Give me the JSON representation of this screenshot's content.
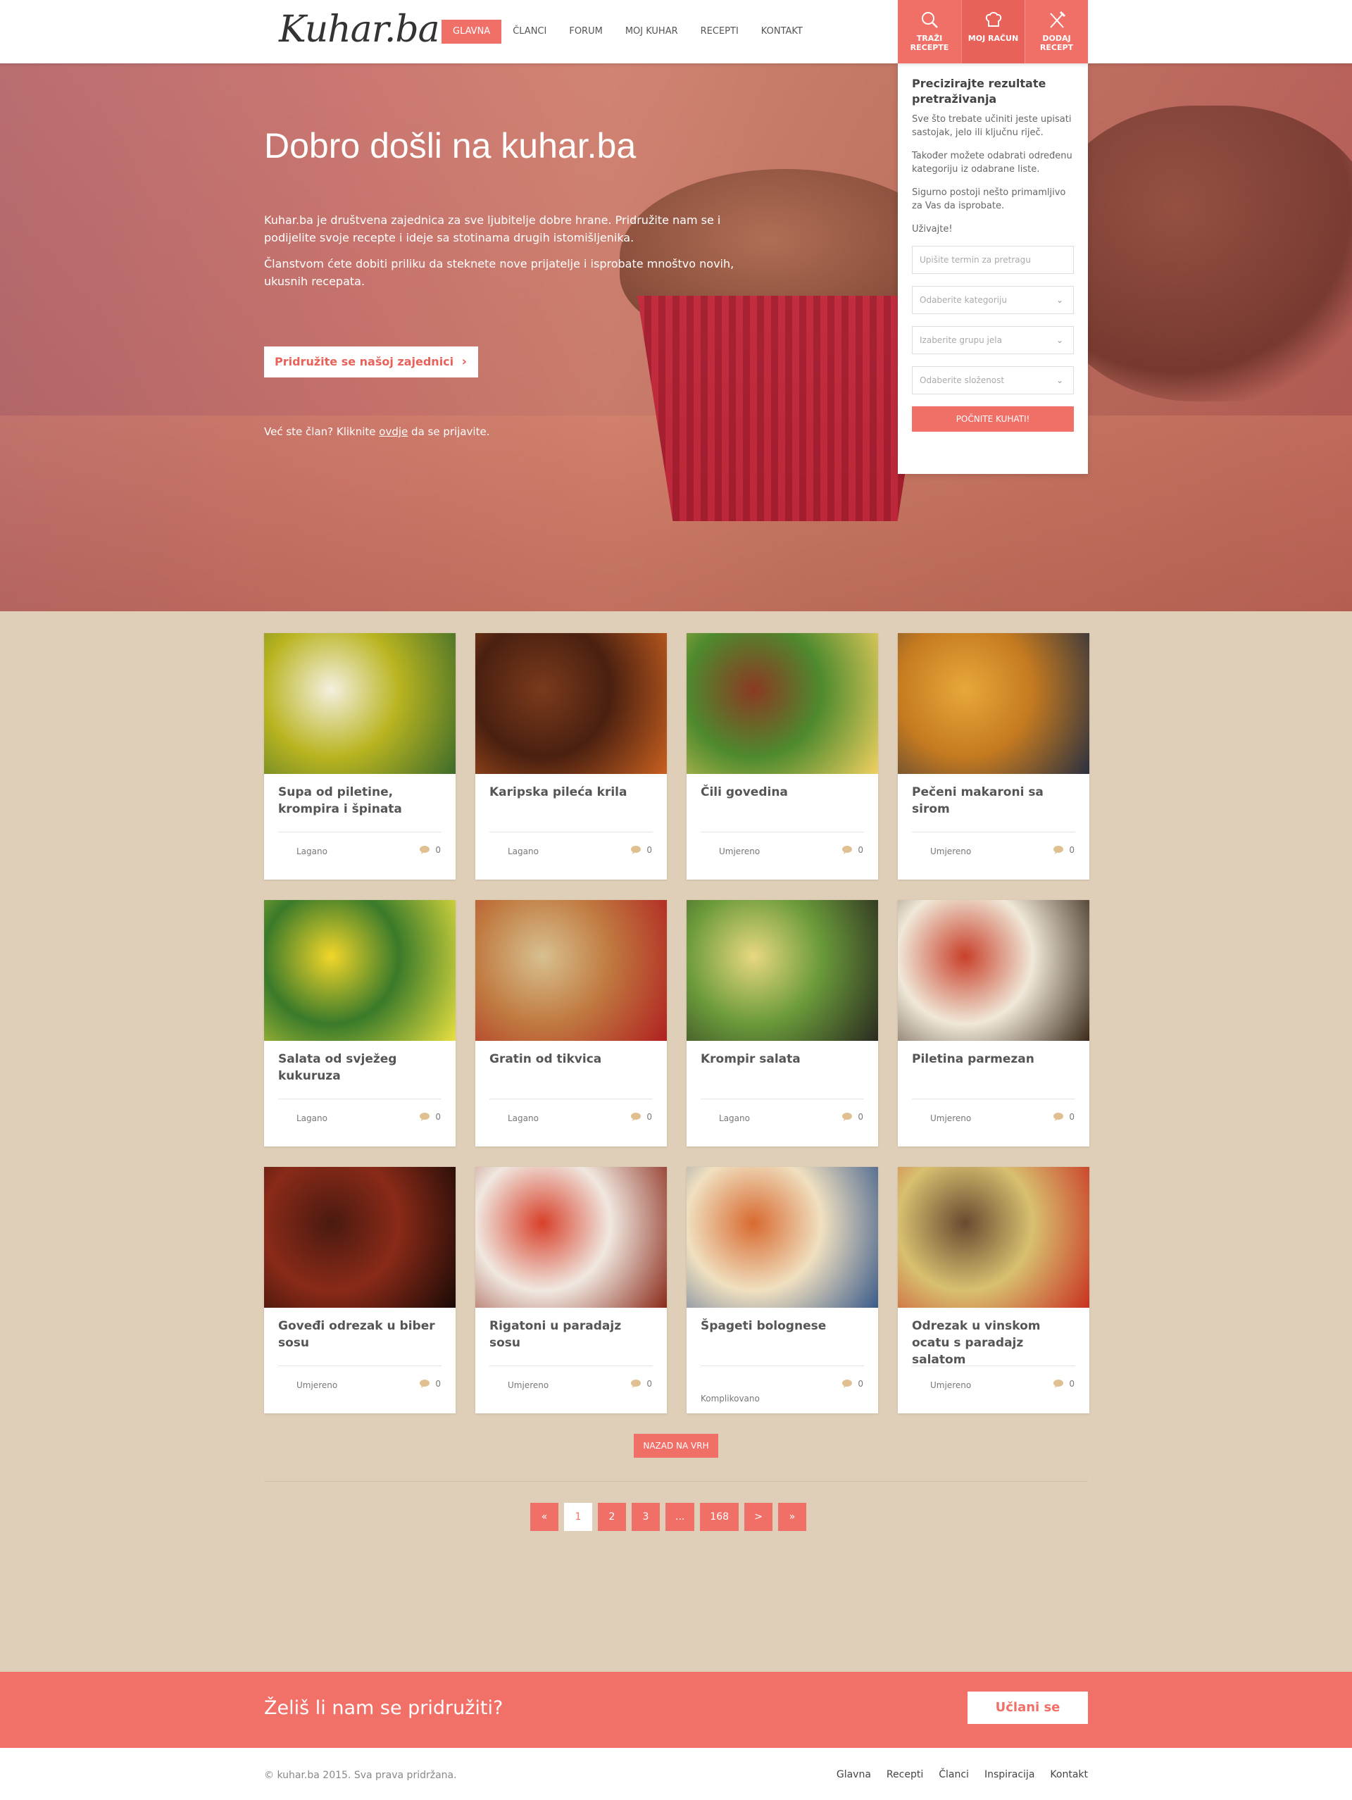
{
  "header": {
    "logo": "Kuhar.ba",
    "nav": [
      "GLAVNA",
      "ČLANCI",
      "FORUM",
      "MOJ KUHAR",
      "RECEPTI",
      "KONTAKT"
    ],
    "active_nav": "GLAVNA",
    "actions": [
      {
        "line1": "TRAŽI",
        "line2": "RECEPTE",
        "icon": "search-icon"
      },
      {
        "line1": "MOJ RAČUN",
        "line2": "",
        "icon": "chef-hat-icon"
      },
      {
        "line1": "DODAJ",
        "line2": "RECEPT",
        "icon": "utensils-icon"
      }
    ]
  },
  "hero": {
    "title": "Dobro došli na kuhar.ba",
    "p1": "Kuhar.ba je društvena zajednica za sve ljubitelje dobre hrane. Pridružite nam se i podijelite svoje recepte i ideje sa stotinama drugih istomišljenika.",
    "p2": "Članstvom ćete dobiti priliku da steknete nove prijatelje i isprobate mnoštvo novih, ukusnih recepata.",
    "join_label": "Pridružite se našoj zajednici",
    "login_prefix": "Već ste član? Kliknite ",
    "login_link": "ovdje",
    "login_suffix": " da se prijavite."
  },
  "panel": {
    "title": "Precizirajte rezultate pretraživanja",
    "p1": "Sve što trebate učiniti jeste upisati sastojak, jelo ili ključnu riječ.",
    "p2": "Također možete odabrati određenu kategoriju iz odabrane liste.",
    "p3": "Sigurno postoji nešto primamljivo za Vas da isprobate.",
    "p4": "Uživajte!",
    "search_placeholder": "Upišite termin za pretragu",
    "select_category": "Odaberite kategoriju",
    "select_group": "Izaberite grupu jela",
    "select_difficulty": "Odaberite složenost",
    "submit": "POČNITE KUHATI!"
  },
  "recipes": [
    {
      "title": "Supa od piletine, krompira i špinata",
      "difficulty": "Lagano",
      "comments": "0",
      "colors": [
        "#f4f0e0",
        "#b9b420",
        "#3d6b2a"
      ]
    },
    {
      "title": "Karipska pileća krila",
      "difficulty": "Lagano",
      "comments": "0",
      "colors": [
        "#7a3a1c",
        "#4a2010",
        "#c86020"
      ]
    },
    {
      "title": "Čili govedina",
      "difficulty": "Umjereno",
      "comments": "0",
      "colors": [
        "#8a3a22",
        "#4e8a2e",
        "#f0d060"
      ]
    },
    {
      "title": "Pečeni makaroni sa sirom",
      "difficulty": "Umjereno",
      "comments": "0",
      "colors": [
        "#e8a83a",
        "#c47a20",
        "#2a3040"
      ]
    },
    {
      "title": "Salata od svježeg kukuruza",
      "difficulty": "Lagano",
      "comments": "0",
      "colors": [
        "#f2d62a",
        "#3a7a2a",
        "#e8e040"
      ]
    },
    {
      "title": "Gratin od tikvica",
      "difficulty": "Lagano",
      "comments": "0",
      "colors": [
        "#d8c090",
        "#c07a40",
        "#b02020"
      ]
    },
    {
      "title": "Krompir salata",
      "difficulty": "Lagano",
      "comments": "0",
      "colors": [
        "#e8d880",
        "#6a9a3a",
        "#2a2a20"
      ]
    },
    {
      "title": "Piletina parmezan",
      "difficulty": "Umjereno",
      "comments": "0",
      "colors": [
        "#c8402a",
        "#f0e8d8",
        "#3a2a1a"
      ]
    },
    {
      "title": "Goveđi odrezak u biber sosu",
      "difficulty": "Umjereno",
      "comments": "0",
      "colors": [
        "#4a1a10",
        "#8a2a18",
        "#1a0a06"
      ]
    },
    {
      "title": "Rigatoni u paradajz sosu",
      "difficulty": "Umjereno",
      "comments": "0",
      "colors": [
        "#d8402a",
        "#f0e8e0",
        "#8a2a1a"
      ]
    },
    {
      "title": "Špageti bolognese",
      "difficulty": "Komplikovano",
      "comments": "0",
      "colors": [
        "#d86a30",
        "#f0e0c0",
        "#3a5a8a"
      ]
    },
    {
      "title": "Odrezak u vinskom ocatu s paradajz salatom",
      "difficulty": "Umjereno",
      "comments": "0",
      "colors": [
        "#6a4a30",
        "#d8c070",
        "#c83020"
      ]
    }
  ],
  "to_top": "NAZAD NA VRH",
  "pagination": [
    "«",
    "1",
    "2",
    "3",
    "...",
    "168",
    ">",
    "»"
  ],
  "active_page": "1",
  "cta": {
    "text": "Želiš li nam se pridružiti?",
    "button": "Učlani se"
  },
  "footer": {
    "copyright": "© kuhar.ba 2015. Sva prava pridržana.",
    "links": [
      "Glavna",
      "Recepti",
      "Članci",
      "Inspiracija",
      "Kontakt"
    ]
  }
}
